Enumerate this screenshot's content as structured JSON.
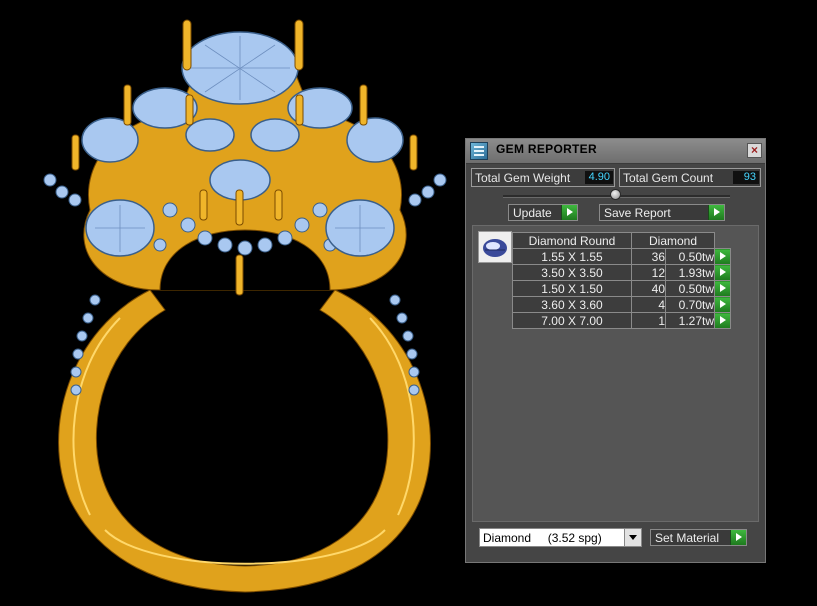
{
  "window": {
    "title": "GEM REPORTER",
    "close_glyph": "×"
  },
  "stats": {
    "total_weight_label": "Total Gem Weight",
    "total_weight_value": "4.90",
    "total_count_label": "Total Gem Count",
    "total_count_value": "93"
  },
  "toolbar": {
    "update_label": "Update",
    "save_label": "Save Report"
  },
  "gem_table": {
    "headers": [
      "Diamond Round",
      "Diamond"
    ],
    "rows": [
      {
        "size": "1.55 X 1.55",
        "count": "36",
        "weight": "0.50tw"
      },
      {
        "size": "3.50 X 3.50",
        "count": "12",
        "weight": "1.93tw"
      },
      {
        "size": "1.50 X 1.50",
        "count": "40",
        "weight": "0.50tw"
      },
      {
        "size": "3.60 X 3.60",
        "count": "4",
        "weight": "0.70tw"
      },
      {
        "size": "7.00 X 7.00",
        "count": "1",
        "weight": "1.27tw"
      }
    ]
  },
  "material": {
    "selected": "Diamond     (3.52 spg)",
    "set_label": "Set Material"
  },
  "icons": {
    "title": "gem-reporter-icon",
    "close": "close-icon",
    "gem_thumb": "diamond-thumbnail-icon"
  },
  "colors": {
    "metal": "#e0a21c",
    "gem": "#a9c8f0",
    "value_text": "#45d6ff",
    "accent_green": "#2e9a2e"
  }
}
